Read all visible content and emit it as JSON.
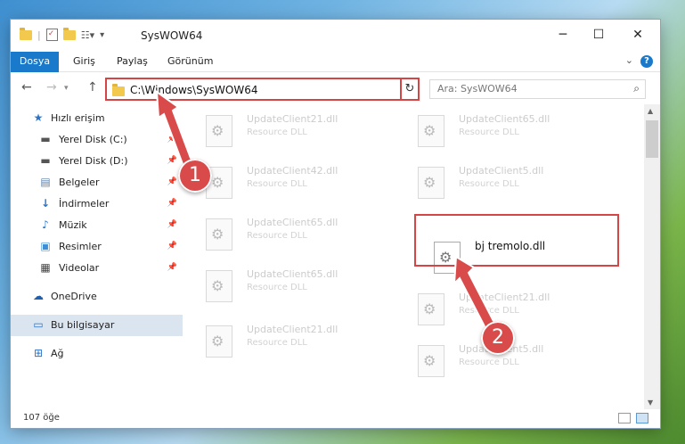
{
  "window": {
    "title": "SysWOW64"
  },
  "ribbon": {
    "tabs": [
      "Dosya",
      "Giriş",
      "Paylaş",
      "Görünüm"
    ]
  },
  "address": {
    "path": "C:\\Windows\\SysWOW64"
  },
  "search": {
    "placeholder": "Ara: SysWOW64"
  },
  "sidebar": {
    "quick_access": "Hızlı erişim",
    "items": [
      "Yerel Disk (C:)",
      "Yerel Disk (D:)",
      "Belgeler",
      "İndirmeler",
      "Müzik",
      "Resimler",
      "Videolar"
    ],
    "onedrive": "OneDrive",
    "this_pc": "Bu bilgisayar",
    "network": "Ağ"
  },
  "files": [
    {
      "name": "UpdateClient21.dll",
      "type": "Resource DLL"
    },
    {
      "name": "UpdateClient65.dll",
      "type": "Resource DLL"
    },
    {
      "name": "UpdateClient42.dll",
      "type": "Resource DLL"
    },
    {
      "name": "UpdateClient5.dll",
      "type": "Resource DLL"
    },
    {
      "name": "UpdateClient65.dll",
      "type": "Resource DLL"
    },
    {
      "name": "bj tremolo.dll",
      "type": ""
    },
    {
      "name": "UpdateClient65.dll",
      "type": "Resource DLL"
    },
    {
      "name": "UpdateClient21.dll",
      "type": "Resource DLL"
    },
    {
      "name": "UpdateClient21.dll",
      "type": "Resource DLL"
    },
    {
      "name": "UpdateClient5.dll",
      "type": "Resource DLL"
    }
  ],
  "status": {
    "count": "107 öğe"
  },
  "steps": [
    "1",
    "2"
  ],
  "colors": {
    "accent": "#1979ca",
    "highlight": "#d64545"
  },
  "icons": [
    "folder-icon",
    "back-icon",
    "forward-icon",
    "up-icon",
    "refresh-icon",
    "search-icon",
    "pin-icon",
    "gear-icon"
  ]
}
